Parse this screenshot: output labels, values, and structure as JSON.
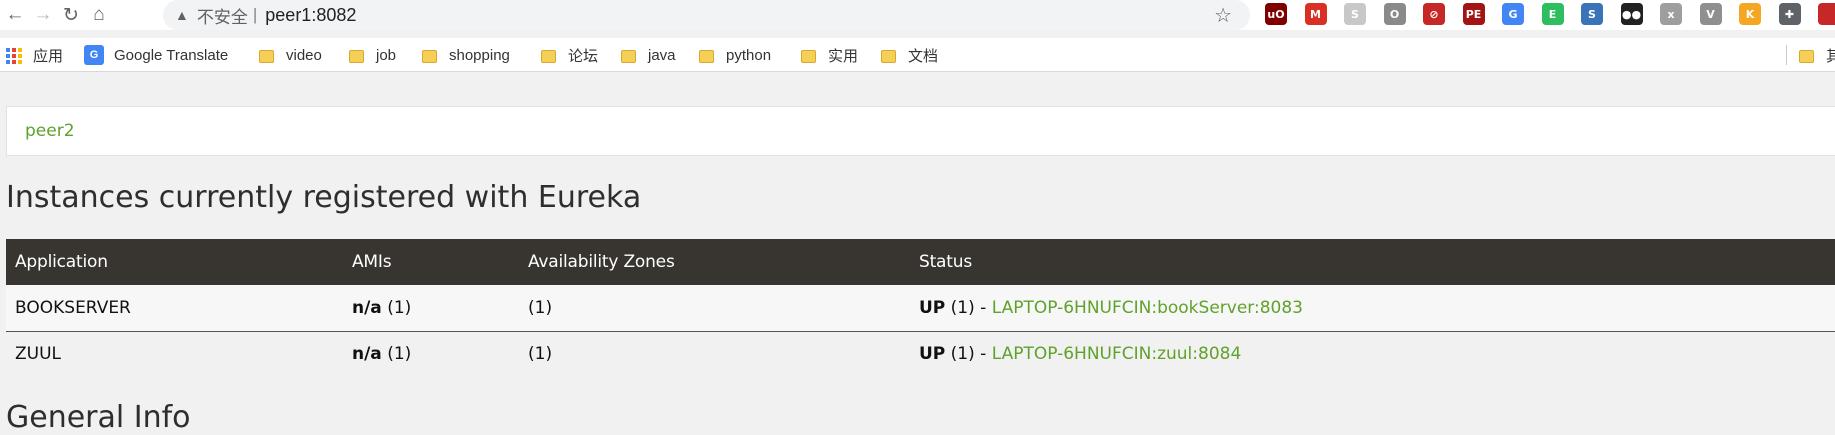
{
  "toolbar": {
    "back_icon": "←",
    "forward_icon": "→",
    "reload_icon": "↻",
    "home_icon": "⌂",
    "security_warning_icon": "▲",
    "insecure_label": "不安全",
    "separator": "|",
    "url": "peer1:8082",
    "star_icon": "☆",
    "extensions": [
      {
        "name": "ublock-icon",
        "glyph": "uO",
        "color": "#800000"
      },
      {
        "name": "gmail-icon",
        "glyph": "M",
        "color": "#d93025"
      },
      {
        "name": "extension-grey-icon",
        "glyph": "S",
        "color": "#c8c8c8"
      },
      {
        "name": "ring-icon",
        "glyph": "O",
        "color": "#8a8a8a"
      },
      {
        "name": "block-icon",
        "glyph": "⊘",
        "color": "#c62828"
      },
      {
        "name": "pdf-icon",
        "glyph": "PE",
        "color": "#a31515"
      },
      {
        "name": "google-translate-icon",
        "glyph": "G",
        "color": "#4285f4"
      },
      {
        "name": "evernote-icon",
        "glyph": "E",
        "color": "#2dbe60"
      },
      {
        "name": "script-icon",
        "glyph": "S",
        "color": "#3b73b9"
      },
      {
        "name": "tampermonkey-icon",
        "glyph": "●●",
        "color": "#222222"
      },
      {
        "name": "disabled-extension-icon",
        "glyph": "x",
        "color": "#9e9e9e"
      },
      {
        "name": "vue-devtools-icon",
        "glyph": "V",
        "color": "#8f8f8f"
      },
      {
        "name": "orange-extension-icon",
        "glyph": "K",
        "color": "#f5a623"
      },
      {
        "name": "puzzle-icon",
        "glyph": "✚",
        "color": "#5f6368"
      },
      {
        "name": "profile-flag-icon",
        "glyph": "",
        "color": "#c62828"
      }
    ]
  },
  "bookmarks": {
    "apps_label": "应用",
    "google_translate": "Google Translate",
    "folders": [
      "video",
      "job",
      "shopping",
      "论坛",
      "java",
      "python",
      "实用",
      "文档"
    ],
    "far_right_folder_label": "其"
  },
  "page": {
    "replica": "peer2",
    "instances_title": "Instances currently registered with Eureka",
    "general_title": "General Info",
    "table": {
      "headers": [
        "Application",
        "AMIs",
        "Availability Zones",
        "Status"
      ],
      "rows": [
        {
          "application": "BOOKSERVER",
          "amis_bold": "n/a",
          "amis_count": " (1)",
          "zones": "(1)",
          "status_bold": "UP",
          "status_count": " (1) - ",
          "instance": "LAPTOP-6HNUFCIN:bookServer:8083"
        },
        {
          "application": "ZUUL",
          "amis_bold": "n/a",
          "amis_count": " (1)",
          "zones": "(1)",
          "status_bold": "UP",
          "status_count": " (1) - ",
          "instance": "LAPTOP-6HNUFCIN:zuul:8084"
        }
      ]
    }
  }
}
